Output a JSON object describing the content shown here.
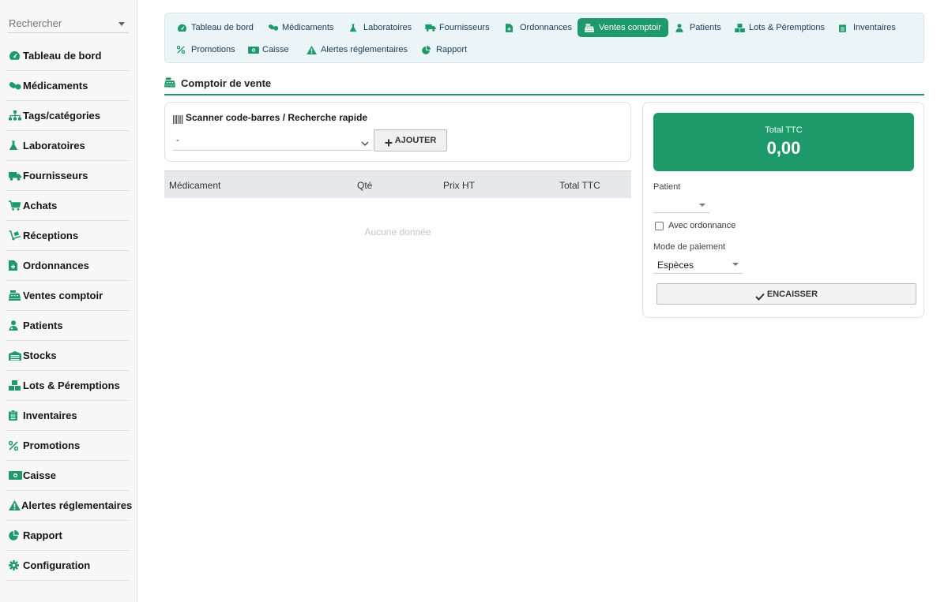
{
  "colors": {
    "accent": "#1e9a6a",
    "nav_bg": "#ebf4f6",
    "sidebar_bg": "#f7f7f7",
    "icon": "#1e9a6a"
  },
  "sidebar": {
    "search_placeholder": "Rechercher",
    "items": [
      {
        "label": "Tableau de bord",
        "icon": "dashboard-icon"
      },
      {
        "label": "Médicaments",
        "icon": "pills-icon"
      },
      {
        "label": "Tags/catégories",
        "icon": "sitemap-icon"
      },
      {
        "label": "Laboratoires",
        "icon": "flask-icon"
      },
      {
        "label": "Fournisseurs",
        "icon": "truck-icon"
      },
      {
        "label": "Achats",
        "icon": "cart-icon"
      },
      {
        "label": "Réceptions",
        "icon": "dolly-icon"
      },
      {
        "label": "Ordonnances",
        "icon": "prescription-icon"
      },
      {
        "label": "Ventes comptoir",
        "icon": "cash-register-icon"
      },
      {
        "label": "Patients",
        "icon": "user-icon"
      },
      {
        "label": "Stocks",
        "icon": "warehouse-icon"
      },
      {
        "label": "Lots & Péremptions",
        "icon": "boxes-icon"
      },
      {
        "label": "Inventaires",
        "icon": "clipboard-icon"
      },
      {
        "label": "Promotions",
        "icon": "percent-icon"
      },
      {
        "label": "Caisse",
        "icon": "money-icon"
      },
      {
        "label": "Alertes réglementaires",
        "icon": "warning-icon"
      },
      {
        "label": "Rapport",
        "icon": "pie-chart-icon"
      },
      {
        "label": "Configuration",
        "icon": "gear-icon"
      }
    ]
  },
  "topnav": {
    "tabs": [
      {
        "label": "Tableau de bord",
        "icon": "dashboard-icon",
        "active": false
      },
      {
        "label": "Médicaments",
        "icon": "pills-icon",
        "active": false
      },
      {
        "label": "Laboratoires",
        "icon": "flask-icon",
        "active": false
      },
      {
        "label": "Fournisseurs",
        "icon": "truck-icon",
        "active": false
      },
      {
        "label": "Ordonnances",
        "icon": "prescription-icon",
        "active": false
      },
      {
        "label": "Ventes comptoir",
        "icon": "cash-register-icon",
        "active": true
      },
      {
        "label": "Patients",
        "icon": "user-icon",
        "active": false
      },
      {
        "label": "Lots & Péremptions",
        "icon": "boxes-icon",
        "active": false
      },
      {
        "label": "Inventaires",
        "icon": "clipboard-icon",
        "active": false
      },
      {
        "label": "Promotions",
        "icon": "percent-icon",
        "active": false
      },
      {
        "label": "Caisse",
        "icon": "money-icon",
        "active": false
      },
      {
        "label": "Alertes réglementaires",
        "icon": "warning-icon",
        "active": false
      },
      {
        "label": "Rapport",
        "icon": "pie-chart-icon",
        "active": false
      }
    ]
  },
  "section": {
    "title": "Comptoir de vente",
    "icon": "cash-register-icon"
  },
  "scanner": {
    "title": "Scanner code-barres / Recherche rapide",
    "select_value": "-",
    "add_label": "AJOUTER"
  },
  "table": {
    "columns": [
      "Médicament",
      "Qté",
      "Prix HT",
      "Total TTC"
    ],
    "empty_text": "Aucune donnée"
  },
  "summary": {
    "total_label": "Total TTC",
    "total_value": "0,00",
    "patient_label": "Patient",
    "patient_value": "",
    "ordonnance_label": "Avec ordonnance",
    "ordonnance_checked": false,
    "payment_label": "Mode de paiement",
    "payment_value": "Espèces",
    "encaisser_label": "ENCAISSER"
  }
}
